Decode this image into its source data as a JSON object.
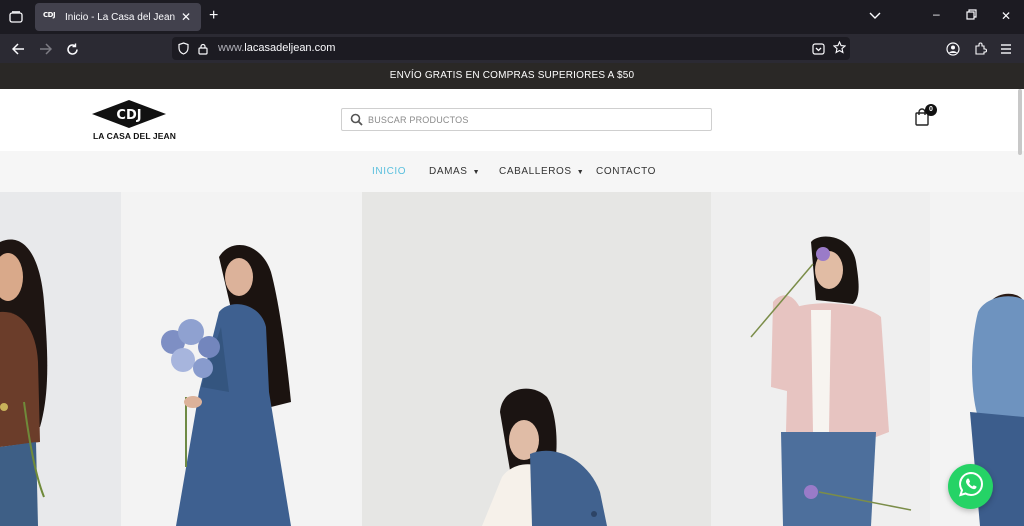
{
  "browser": {
    "tab_title": "Inicio - La Casa del Jean",
    "tab_favicon_text": "CDJ",
    "url_host": "lacasadeljean.com",
    "url_prefix": "www."
  },
  "site": {
    "promo_text": "ENVÍO GRATIS EN COMPRAS SUPERIORES A $50",
    "logo_text": "CDJ",
    "logo_subtitle": "LA CASA DEL JEAN",
    "search_placeholder": "BUSCAR PRODUCTOS",
    "cart_count": "0",
    "menu": [
      {
        "label": "INICIO",
        "active": true
      },
      {
        "label": "DAMAS",
        "dropdown": true
      },
      {
        "label": "CABALLEROS",
        "dropdown": true
      },
      {
        "label": "CONTACTO"
      }
    ]
  },
  "colors": {
    "accent": "#5bc0de",
    "promo_bg": "#2a2826",
    "whatsapp": "#25d366"
  },
  "icons": [
    "tab-list-icon",
    "close-icon",
    "plus-icon",
    "chevron-down-icon",
    "minimize-icon",
    "maximize-icon",
    "back-icon",
    "forward-icon",
    "reload-icon",
    "shield-icon",
    "lock-icon",
    "save-to-pocket-icon",
    "star-icon",
    "account-icon",
    "extensions-icon",
    "menu-icon",
    "search-icon",
    "shopping-bag-icon",
    "whatsapp-icon"
  ]
}
